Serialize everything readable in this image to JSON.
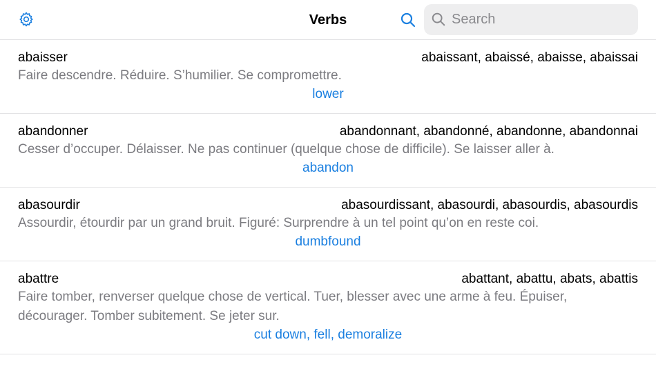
{
  "header": {
    "title": "Verbs",
    "settings_icon": "gear-icon",
    "search_icon": "magnifier-icon",
    "search_placeholder": "Search",
    "accent_color": "#1a7fe0"
  },
  "verbs": [
    {
      "infinitive": "abaisser",
      "forms": "abaissant, abaissé, abaisse, abaissai",
      "definition": "Faire descendre. Réduire. S’humilier. Se compromettre.",
      "translation": "lower"
    },
    {
      "infinitive": "abandonner",
      "forms": "abandonnant, abandonné, abandonne, abandonnai",
      "definition": "Cesser d’occuper. Délaisser. Ne pas continuer (quelque chose de difficile). Se laisser aller à.",
      "translation": "abandon"
    },
    {
      "infinitive": "abasourdir",
      "forms": "abasourdissant, abasourdi, abasourdis, abasourdis",
      "definition": "Assourdir, étourdir par un grand bruit. Figuré: Surprendre à un tel point qu’on en reste coi.",
      "translation": "dumbfound"
    },
    {
      "infinitive": "abattre",
      "forms": "abattant, abattu, abats, abattis",
      "definition": "Faire tomber, renverser quelque chose de vertical. Tuer, blesser avec une arme à feu. Épuiser, décourager. Tomber subitement. Se jeter sur.",
      "translation": "cut down, fell, demoralize"
    }
  ]
}
